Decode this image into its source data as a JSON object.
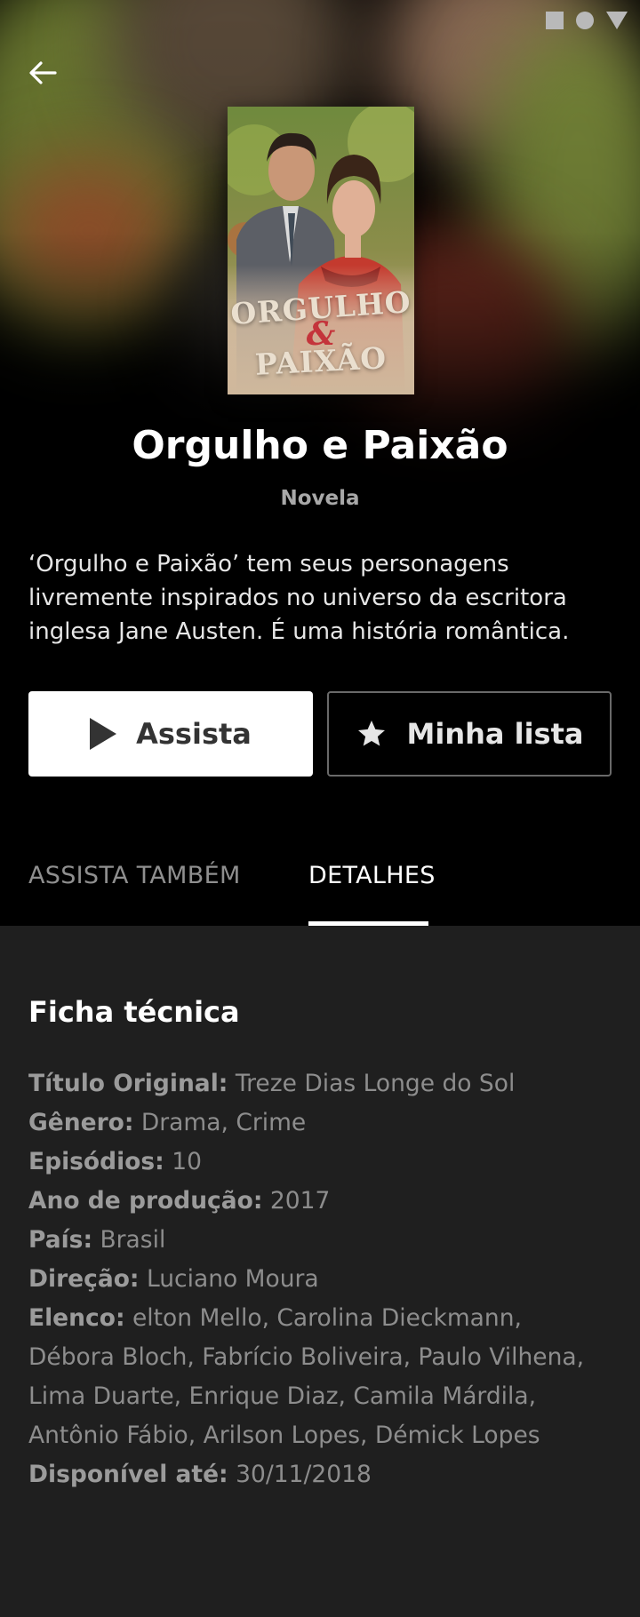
{
  "status_bar": {
    "icons": [
      "square-icon",
      "circle-icon",
      "triangle-icon"
    ]
  },
  "header": {
    "back_icon": "arrow-left-icon"
  },
  "poster": {
    "title_line1": "ORGULHO",
    "title_amp": "&",
    "title_line2": "PAIXÃO"
  },
  "show": {
    "title": "Orgulho e Paixão",
    "category": "Novela",
    "description": "‘Orgulho e Paixão’ tem seus personagens livremente inspirados no universo da escritora inglesa Jane Austen. É uma história romântica."
  },
  "actions": {
    "watch_label": "Assista",
    "list_label": "Minha lista"
  },
  "tabs": [
    {
      "label": "ASSISTA TAMBÉM",
      "active": false
    },
    {
      "label": "DETALHES",
      "active": true
    }
  ],
  "details": {
    "section_title": "Ficha técnica",
    "rows": [
      {
        "key": "Título Original:",
        "value": "Treze Dias Longe do Sol"
      },
      {
        "key": "Gênero:",
        "value": "Drama, Crime"
      },
      {
        "key": "Episódios:",
        "value": "10"
      },
      {
        "key": "Ano de produção:",
        "value": "2017"
      },
      {
        "key": "País:",
        "value": "Brasil"
      },
      {
        "key": "Direção:",
        "value": "Luciano Moura"
      },
      {
        "key": "Elenco:",
        "value": "elton Mello, Carolina Dieckmann, Débora Bloch, Fabrício Boliveira, Paulo Vilhena, Lima Duarte, Enrique Diaz, Camila Márdila, Antônio Fábio, Arilson Lopes, Démick Lopes"
      },
      {
        "key": "Disponível até:",
        "value": "30/11/2018"
      }
    ]
  },
  "colors": {
    "background": "#1f1f1f",
    "hero": "#000000",
    "accent": "#ffffff"
  }
}
